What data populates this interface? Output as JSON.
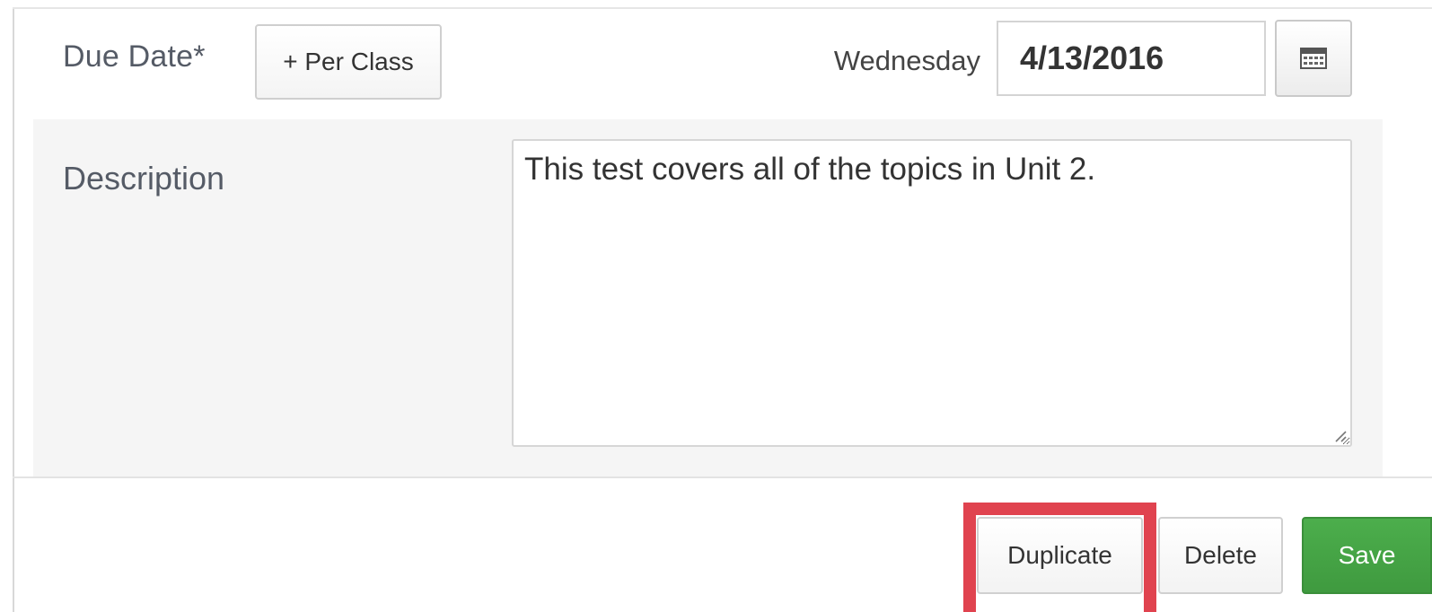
{
  "due_date": {
    "label": "Due Date*",
    "per_class_label": "+ Per Class",
    "weekday": "Wednesday",
    "value": "4/13/2016",
    "calendar_icon": "calendar-icon"
  },
  "description": {
    "label": "Description",
    "value": "This test covers all of the topics in Unit 2."
  },
  "footer": {
    "duplicate_label": "Duplicate",
    "delete_label": "Delete",
    "save_label": "Save"
  },
  "colors": {
    "highlight": "#e0434f",
    "save_button": "#449d44",
    "description_band": "#f5f5f5"
  }
}
